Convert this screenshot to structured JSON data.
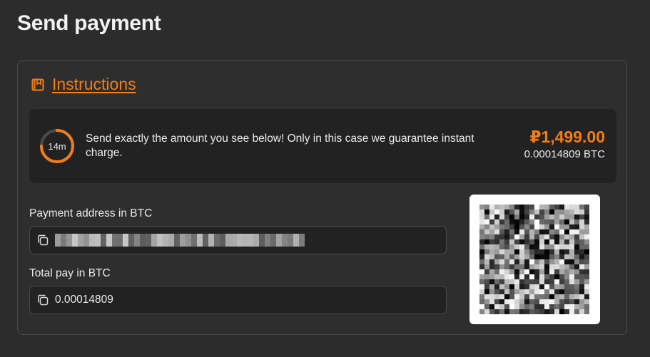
{
  "page": {
    "title": "Send payment"
  },
  "instructions": {
    "label": "Instructions",
    "icon": "book-icon"
  },
  "notice": {
    "timer": "14m",
    "timer_progress": 0.75,
    "message": "Send exactly the amount you see below! Only in this case we guarantee instant charge.",
    "amount_fiat": "₽1,499.00",
    "amount_crypto": "0.00014809 BTC"
  },
  "address": {
    "label": "Payment address in BTC",
    "value": "",
    "redacted": true,
    "copy_icon": "copy-icon"
  },
  "total": {
    "label": "Total pay in BTC",
    "value": "0.00014809",
    "copy_icon": "copy-icon"
  },
  "qr": {
    "redacted": true
  },
  "colors": {
    "accent": "#f07d1a",
    "background": "#2c2c2c",
    "panel": "#222222",
    "border": "#4a4a4a"
  }
}
